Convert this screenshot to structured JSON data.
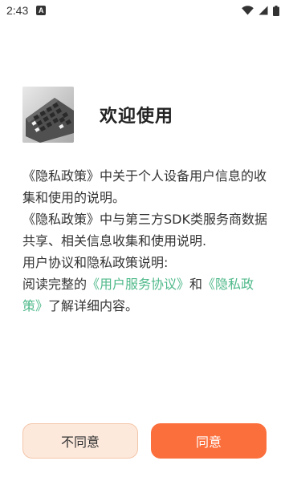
{
  "status_bar": {
    "time": "2:43",
    "notification_badge": "A",
    "icons": [
      "wifi-icon",
      "cellular-signal-icon",
      "battery-icon"
    ]
  },
  "dialog": {
    "title": "欢迎使用",
    "hero_image": "keyboard-photo",
    "paragraphs": {
      "p1": "《隐私政策》中关于个人设备用户信息的收集和使用的说明。",
      "p2": "《隐私政策》中与第三方SDK类服务商数据共享、相关信息收集和使用说明.",
      "p3": "用户协议和隐私政策说明:"
    },
    "read_line": {
      "prefix": "阅读完整的",
      "user_agreement_link": "《用户服务协议》",
      "conjunction": "和",
      "privacy_policy_link": "《隐私政策》",
      "suffix": "了解详细内容。"
    },
    "buttons": {
      "disagree_label": "不同意",
      "agree_label": "同意"
    }
  },
  "colors": {
    "link": "#4fb98a",
    "agree_button": "#fb6f3c",
    "disagree_button_bg": "#fde9dc",
    "disagree_button_border": "#f2c6a9"
  }
}
